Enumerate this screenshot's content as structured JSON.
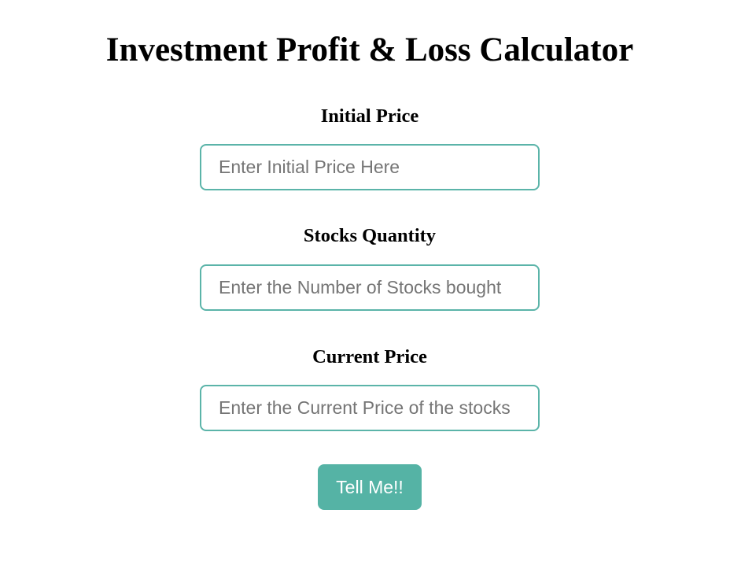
{
  "page": {
    "title": "Investment Profit & Loss Calculator"
  },
  "form": {
    "fields": [
      {
        "label": "Initial Price",
        "placeholder": "Enter Initial Price Here",
        "value": ""
      },
      {
        "label": "Stocks Quantity",
        "placeholder": "Enter the Number of Stocks bought",
        "value": ""
      },
      {
        "label": "Current Price",
        "placeholder": "Enter the Current Price of the stocks",
        "value": ""
      }
    ],
    "submit_label": "Tell Me!!"
  },
  "colors": {
    "accent": "#55b3a5",
    "input_border": "#5bb4a9",
    "placeholder": "#757575",
    "button_text": "#ffffff",
    "background": "#ffffff"
  }
}
